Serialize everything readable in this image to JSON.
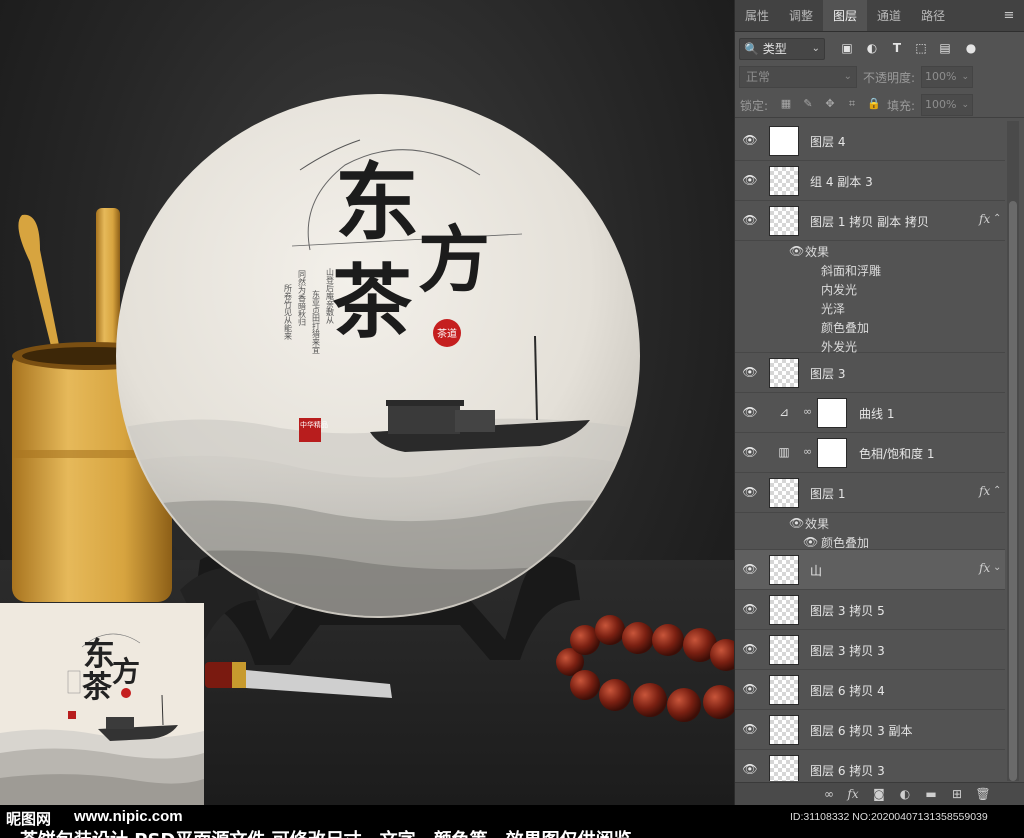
{
  "poster": {
    "title_char_1": "东",
    "title_char_2": "方",
    "title_char_3": "茶",
    "seal_text": "茶道",
    "side_seal_text": "中华精品",
    "poem_lines": [
      "山登后庵亲敷从",
      "东亚贞田打猎来宜",
      "同然为香暗秋归",
      "所卷竹见从能来"
    ]
  },
  "watermark": {
    "brand": "昵图网",
    "url": "www.nipic.com",
    "id_text": "ID:31108332 NO:20200407131358559039",
    "caption": "茶饼包装设计  PSD平面源文件 可修改尺寸，文字，颜色等，效果图仅供阅览"
  },
  "panel": {
    "tabs": [
      "属性",
      "调整",
      "图层",
      "通道",
      "路径"
    ],
    "active_tab": "图层",
    "menu_icon": "≡",
    "filter_label": "类型",
    "blend_mode": "正常",
    "opacity_label": "不透明度:",
    "opacity_value": "100%",
    "lock_label": "锁定:",
    "fill_label": "填充:",
    "fill_value": "100%",
    "fx_label": "fx"
  },
  "layers": [
    {
      "name": "图层 4",
      "type": "pixel",
      "fx": false
    },
    {
      "name": "组 4 副本 3",
      "type": "pixel",
      "fx": false
    },
    {
      "name": "图层 1 拷贝 副本 拷贝",
      "type": "pixel",
      "fx": true,
      "effects_label": "效果",
      "effects": [
        "斜面和浮雕",
        "内发光",
        "光泽",
        "颜色叠加",
        "外发光"
      ]
    },
    {
      "name": "图层 3",
      "type": "pixel",
      "fx": false
    },
    {
      "name": "曲线 1",
      "type": "adjustment",
      "icon": "curves-icon"
    },
    {
      "name": "色相/饱和度 1",
      "type": "adjustment",
      "icon": "hue-saturation-icon"
    },
    {
      "name": "图层 1",
      "type": "pixel",
      "fx": true,
      "effects_label": "效果",
      "effects": [
        "颜色叠加"
      ]
    },
    {
      "name": "山",
      "type": "pixel",
      "fx": true,
      "selected": true
    },
    {
      "name": "图层 3 拷贝 5",
      "type": "pixel",
      "fx": false
    },
    {
      "name": "图层 3 拷贝 3",
      "type": "pixel",
      "fx": false
    },
    {
      "name": "图层 6 拷贝 4",
      "type": "pixel",
      "fx": false
    },
    {
      "name": "图层 6 拷贝 3 副本",
      "type": "pixel",
      "fx": false
    },
    {
      "name": "图层 6 拷贝 3",
      "type": "pixel",
      "fx": false
    }
  ]
}
